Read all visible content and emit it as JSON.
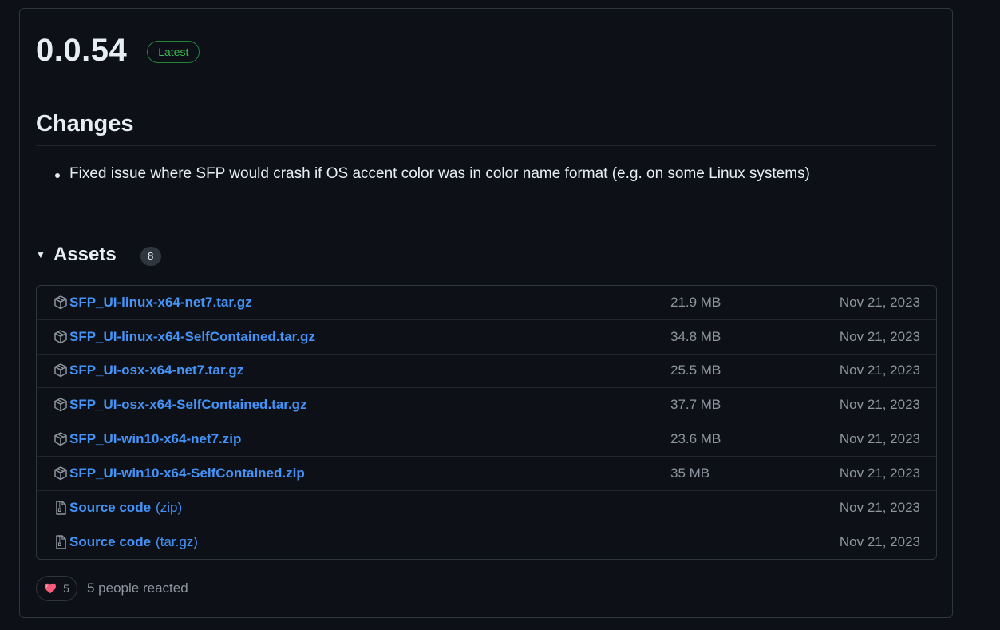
{
  "release": {
    "version": "0.0.54",
    "badge": "Latest",
    "changes_heading": "Changes",
    "changes": [
      "Fixed issue where SFP would crash if OS accent color was in color name format (e.g. on some Linux systems)"
    ]
  },
  "assets": {
    "title": "Assets",
    "count": "8",
    "items": [
      {
        "name": "SFP_UI-linux-x64-net7.tar.gz",
        "suffix": "",
        "size": "21.9 MB",
        "date": "Nov 21, 2023",
        "icon": "package-icon"
      },
      {
        "name": "SFP_UI-linux-x64-SelfContained.tar.gz",
        "suffix": "",
        "size": "34.8 MB",
        "date": "Nov 21, 2023",
        "icon": "package-icon"
      },
      {
        "name": "SFP_UI-osx-x64-net7.tar.gz",
        "suffix": "",
        "size": "25.5 MB",
        "date": "Nov 21, 2023",
        "icon": "package-icon"
      },
      {
        "name": "SFP_UI-osx-x64-SelfContained.tar.gz",
        "suffix": "",
        "size": "37.7 MB",
        "date": "Nov 21, 2023",
        "icon": "package-icon"
      },
      {
        "name": "SFP_UI-win10-x64-net7.zip",
        "suffix": "",
        "size": "23.6 MB",
        "date": "Nov 21, 2023",
        "icon": "package-icon"
      },
      {
        "name": "SFP_UI-win10-x64-SelfContained.zip",
        "suffix": "",
        "size": "35 MB",
        "date": "Nov 21, 2023",
        "icon": "package-icon"
      },
      {
        "name": "Source code",
        "suffix": "(zip)",
        "size": "",
        "date": "Nov 21, 2023",
        "icon": "file-zip-icon"
      },
      {
        "name": "Source code",
        "suffix": "(tar.gz)",
        "size": "",
        "date": "Nov 21, 2023",
        "icon": "file-zip-icon"
      }
    ]
  },
  "reactions": {
    "emoji": "heart-icon",
    "count": "5",
    "text": "5 people reacted"
  },
  "colors": {
    "background": "#0d1117",
    "border": "#30363d",
    "link": "#4493f8",
    "muted": "#8d96a0",
    "latest": "#3fb950"
  }
}
